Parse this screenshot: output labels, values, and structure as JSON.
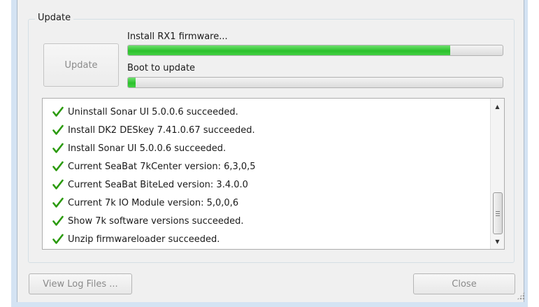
{
  "group": {
    "title": "Update"
  },
  "update_button": {
    "label": "Update"
  },
  "step1": {
    "label": "Install RX1 firmware...",
    "progress": 0.86
  },
  "step2": {
    "label": "Boot to update",
    "progress": 0.02
  },
  "log": {
    "lines": [
      "Uninstall Sonar UI 5.0.0.6 succeeded.",
      "Install DK2 DESkey 7.41.0.67 succeeded.",
      "Install Sonar UI 5.0.0.6 succeeded.",
      "Current SeaBat 7kCenter version: 6,3,0,5",
      "Current SeaBat BiteLed version: 3.4.0.0",
      "Current 7k IO Module version: 5,0,0,6",
      "Show 7k software versions succeeded.",
      "Unzip firmwareloader succeeded."
    ],
    "status_icon": "check-icon",
    "status_color": "#2a9a0c"
  },
  "footer": {
    "view_log_label": "View Log Files ...",
    "close_label": "Close"
  }
}
